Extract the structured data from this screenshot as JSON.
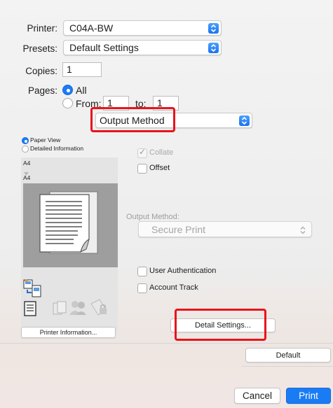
{
  "printer": {
    "label": "Printer:",
    "value": "C04A-BW"
  },
  "presets": {
    "label": "Presets:",
    "value": "Default Settings"
  },
  "copies": {
    "label": "Copies:",
    "value": "1"
  },
  "pages": {
    "label": "Pages:",
    "all_label": "All",
    "from_label": "From:",
    "from_value": "1",
    "to_label": "to:",
    "to_value": "1"
  },
  "section_popup": {
    "value": "Output Method"
  },
  "preview": {
    "paper_view_label": "Paper View",
    "detailed_info_label": "Detailed Information",
    "size_top": "A4",
    "size_bottom": "A4",
    "printer_info_button": "Printer Information..."
  },
  "options": {
    "collate_label": "Collate",
    "offset_label": "Offset",
    "output_method_label": "Output Method:",
    "output_method_value": "Secure Print",
    "user_auth_label": "User Authentication",
    "account_track_label": "Account Track",
    "detail_settings_button": "Detail Settings...",
    "default_button": "Default"
  },
  "footer": {
    "cancel_button": "Cancel",
    "print_button": "Print"
  },
  "colors": {
    "accent": "#1a7cf5",
    "highlight_box": "#e8141b"
  }
}
